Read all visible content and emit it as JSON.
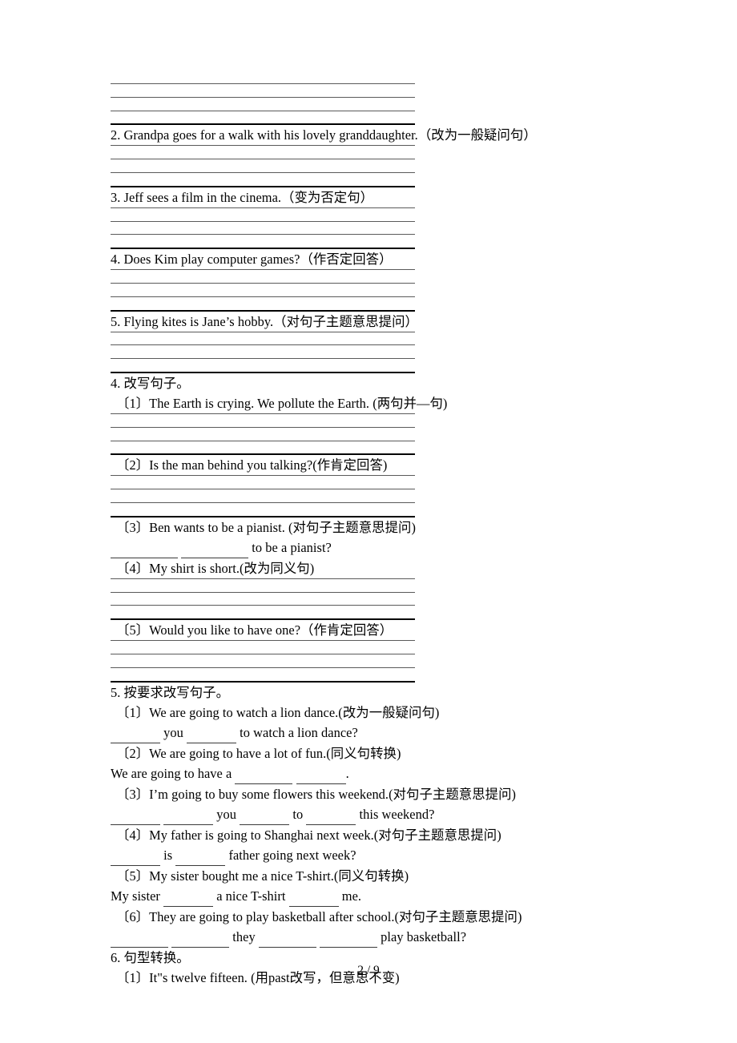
{
  "document": {
    "page_label": "2 / 9",
    "blocks": [
      {
        "kind": "lines",
        "count": 4
      },
      {
        "kind": "text",
        "style": "q",
        "text": "2. Grandpa goes for a walk with his lovely granddaughter.（改为一般疑问句）"
      },
      {
        "kind": "lines",
        "count": 4
      },
      {
        "kind": "text",
        "style": "q",
        "text": "3. Jeff sees a film in the cinema.（变为否定句）"
      },
      {
        "kind": "lines",
        "count": 4
      },
      {
        "kind": "text",
        "style": "q",
        "text": "4. Does Kim play computer games?（作否定回答）"
      },
      {
        "kind": "lines",
        "count": 4
      },
      {
        "kind": "text",
        "style": "q",
        "text": "5. Flying kites is Jane’s hobby.（对句子主题意思提问）"
      },
      {
        "kind": "lines",
        "count": 4
      },
      {
        "kind": "text",
        "style": "head",
        "text": "4. 改写句子。"
      },
      {
        "kind": "text",
        "style": "sub",
        "text": "〔1〕The Earth is crying. We pollute the Earth. (两句并—句)"
      },
      {
        "kind": "lines",
        "count": 4
      },
      {
        "kind": "text",
        "style": "sub",
        "text": "〔2〕Is the man behind you talking?(作肯定回答)"
      },
      {
        "kind": "lines",
        "count": 4
      },
      {
        "kind": "text",
        "style": "sub",
        "text": "〔3〕Ben wants to be a pianist. (对句子主题意思提问)"
      },
      {
        "kind": "blankline",
        "style": "ans",
        "parts": [
          {
            "t": "blank",
            "w": "w3"
          },
          {
            "t": "text",
            "v": " "
          },
          {
            "t": "blank",
            "w": "w3"
          },
          {
            "t": "text",
            "v": " to be a pianist?"
          }
        ]
      },
      {
        "kind": "text",
        "style": "sub",
        "text": "〔4〕My shirt is short.(改为同义句)"
      },
      {
        "kind": "lines",
        "count": 4
      },
      {
        "kind": "text",
        "style": "sub",
        "text": "〔5〕Would you like to have one?（作肯定回答）"
      },
      {
        "kind": "lines",
        "count": 4
      },
      {
        "kind": "text",
        "style": "head",
        "text": "5. 按要求改写句子。"
      },
      {
        "kind": "text",
        "style": "sub",
        "text": "〔1〕We are going to watch a lion dance.(改为一般疑问句)"
      },
      {
        "kind": "blankline",
        "style": "ans",
        "parts": [
          {
            "t": "blank",
            "w": "w1"
          },
          {
            "t": "text",
            "v": " you "
          },
          {
            "t": "blank",
            "w": "w1"
          },
          {
            "t": "text",
            "v": " to watch a lion dance?"
          }
        ]
      },
      {
        "kind": "text",
        "style": "sub",
        "text": "〔2〕We are going to have a lot of fun.(同义句转换)"
      },
      {
        "kind": "blankline",
        "style": "ans",
        "parts": [
          {
            "t": "text",
            "v": "We are going to have a "
          },
          {
            "t": "blank",
            "w": "w2"
          },
          {
            "t": "text",
            "v": " "
          },
          {
            "t": "blank",
            "w": "w1"
          },
          {
            "t": "text",
            "v": "."
          }
        ]
      },
      {
        "kind": "text",
        "style": "sub",
        "text": "〔3〕I’m going to buy some flowers this weekend.(对句子主题意思提问)"
      },
      {
        "kind": "blankline",
        "style": "ans",
        "parts": [
          {
            "t": "blank",
            "w": "w1"
          },
          {
            "t": "text",
            "v": " "
          },
          {
            "t": "blank",
            "w": "w1"
          },
          {
            "t": "text",
            "v": " you "
          },
          {
            "t": "blank",
            "w": "w1"
          },
          {
            "t": "text",
            "v": " to "
          },
          {
            "t": "blank",
            "w": "w1"
          },
          {
            "t": "text",
            "v": " this weekend?"
          }
        ]
      },
      {
        "kind": "text",
        "style": "sub",
        "text": "〔4〕My father is going to Shanghai next week.(对句子主题意思提问)"
      },
      {
        "kind": "blankline",
        "style": "ans",
        "parts": [
          {
            "t": "blank",
            "w": "w1"
          },
          {
            "t": "text",
            "v": " is "
          },
          {
            "t": "blank",
            "w": "w1"
          },
          {
            "t": "text",
            "v": " father going next week?"
          }
        ]
      },
      {
        "kind": "text",
        "style": "sub",
        "text": "〔5〕My sister bought me a nice T-shirt.(同义句转换)"
      },
      {
        "kind": "blankline",
        "style": "ans",
        "parts": [
          {
            "t": "text",
            "v": "My sister "
          },
          {
            "t": "blank",
            "w": "w1"
          },
          {
            "t": "text",
            "v": " a nice T-shirt "
          },
          {
            "t": "blank",
            "w": "w1"
          },
          {
            "t": "text",
            "v": " me."
          }
        ]
      },
      {
        "kind": "text",
        "style": "sub",
        "text": "〔6〕They are going to play basketball after school.(对句子主题意思提问)"
      },
      {
        "kind": "blankline",
        "style": "ans",
        "parts": [
          {
            "t": "blank",
            "w": "w2"
          },
          {
            "t": "text",
            "v": " "
          },
          {
            "t": "blank",
            "w": "w2"
          },
          {
            "t": "text",
            "v": " they "
          },
          {
            "t": "blank",
            "w": "w2"
          },
          {
            "t": "text",
            "v": " "
          },
          {
            "t": "blank",
            "w": "w2"
          },
          {
            "t": "text",
            "v": " play basketball?"
          }
        ]
      },
      {
        "kind": "text",
        "style": "head",
        "text": "6. 句型转换。"
      },
      {
        "kind": "text",
        "style": "sub",
        "text": "〔1〕It\"s twelve fifteen. (用past改写，但意思不变)"
      }
    ]
  }
}
